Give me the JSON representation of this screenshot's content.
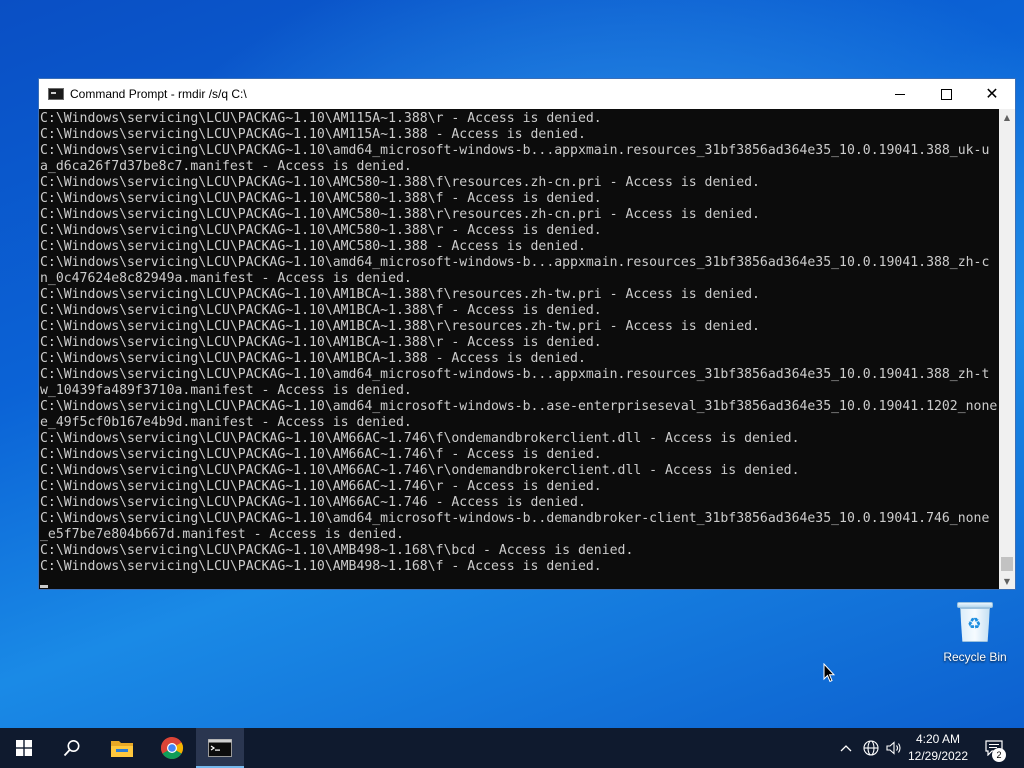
{
  "window": {
    "title": "Command Prompt - rmdir /s/q C:\\",
    "icon": "cmd-icon",
    "controls": [
      "minimize-icon",
      "maximize-icon",
      "close-icon"
    ]
  },
  "console": {
    "lines": [
      "C:\\Windows\\servicing\\LCU\\PACKAG~1.10\\AM115A~1.388\\r - Access is denied.",
      "C:\\Windows\\servicing\\LCU\\PACKAG~1.10\\AM115A~1.388 - Access is denied.",
      "C:\\Windows\\servicing\\LCU\\PACKAG~1.10\\amd64_microsoft-windows-b...appxmain.resources_31bf3856ad364e35_10.0.19041.388_uk-u",
      "a_d6ca26f7d37be8c7.manifest - Access is denied.",
      "C:\\Windows\\servicing\\LCU\\PACKAG~1.10\\AMC580~1.388\\f\\resources.zh-cn.pri - Access is denied.",
      "C:\\Windows\\servicing\\LCU\\PACKAG~1.10\\AMC580~1.388\\f - Access is denied.",
      "C:\\Windows\\servicing\\LCU\\PACKAG~1.10\\AMC580~1.388\\r\\resources.zh-cn.pri - Access is denied.",
      "C:\\Windows\\servicing\\LCU\\PACKAG~1.10\\AMC580~1.388\\r - Access is denied.",
      "C:\\Windows\\servicing\\LCU\\PACKAG~1.10\\AMC580~1.388 - Access is denied.",
      "C:\\Windows\\servicing\\LCU\\PACKAG~1.10\\amd64_microsoft-windows-b...appxmain.resources_31bf3856ad364e35_10.0.19041.388_zh-c",
      "n_0c47624e8c82949a.manifest - Access is denied.",
      "C:\\Windows\\servicing\\LCU\\PACKAG~1.10\\AM1BCA~1.388\\f\\resources.zh-tw.pri - Access is denied.",
      "C:\\Windows\\servicing\\LCU\\PACKAG~1.10\\AM1BCA~1.388\\f - Access is denied.",
      "C:\\Windows\\servicing\\LCU\\PACKAG~1.10\\AM1BCA~1.388\\r\\resources.zh-tw.pri - Access is denied.",
      "C:\\Windows\\servicing\\LCU\\PACKAG~1.10\\AM1BCA~1.388\\r - Access is denied.",
      "C:\\Windows\\servicing\\LCU\\PACKAG~1.10\\AM1BCA~1.388 - Access is denied.",
      "C:\\Windows\\servicing\\LCU\\PACKAG~1.10\\amd64_microsoft-windows-b...appxmain.resources_31bf3856ad364e35_10.0.19041.388_zh-t",
      "w_10439fa489f3710a.manifest - Access is denied.",
      "C:\\Windows\\servicing\\LCU\\PACKAG~1.10\\amd64_microsoft-windows-b..ase-enterpriseseval_31bf3856ad364e35_10.0.19041.1202_none",
      "e_49f5cf0b167e4b9d.manifest - Access is denied.",
      "C:\\Windows\\servicing\\LCU\\PACKAG~1.10\\AM66AC~1.746\\f\\ondemandbrokerclient.dll - Access is denied.",
      "C:\\Windows\\servicing\\LCU\\PACKAG~1.10\\AM66AC~1.746\\f - Access is denied.",
      "C:\\Windows\\servicing\\LCU\\PACKAG~1.10\\AM66AC~1.746\\r\\ondemandbrokerclient.dll - Access is denied.",
      "C:\\Windows\\servicing\\LCU\\PACKAG~1.10\\AM66AC~1.746\\r - Access is denied.",
      "C:\\Windows\\servicing\\LCU\\PACKAG~1.10\\AM66AC~1.746 - Access is denied.",
      "C:\\Windows\\servicing\\LCU\\PACKAG~1.10\\amd64_microsoft-windows-b..demandbroker-client_31bf3856ad364e35_10.0.19041.746_none",
      "_e5f7be7e804b667d.manifest - Access is denied.",
      "C:\\Windows\\servicing\\LCU\\PACKAG~1.10\\AMB498~1.168\\f\\bcd - Access is denied.",
      "C:\\Windows\\servicing\\LCU\\PACKAG~1.10\\AMB498~1.168\\f - Access is denied."
    ]
  },
  "desktop": {
    "recycle_bin_label": "Recycle Bin",
    "recycle_bin_icon": "recycle-bin-icon"
  },
  "taskbar": {
    "items": [
      "start-icon",
      "search-icon",
      "file-explorer-icon",
      "chrome-icon",
      "command-prompt-icon"
    ],
    "tray_icons": [
      "chevron-up-icon",
      "network-icon",
      "volume-icon"
    ],
    "clock_time": "4:20 AM",
    "clock_date": "12/29/2022",
    "notification_count": "2"
  },
  "colors": {
    "console_bg": "#0c0c0c",
    "console_text": "#cccccc",
    "taskbar_bg": "#0f1a2e",
    "accent": "#76b9ed"
  }
}
